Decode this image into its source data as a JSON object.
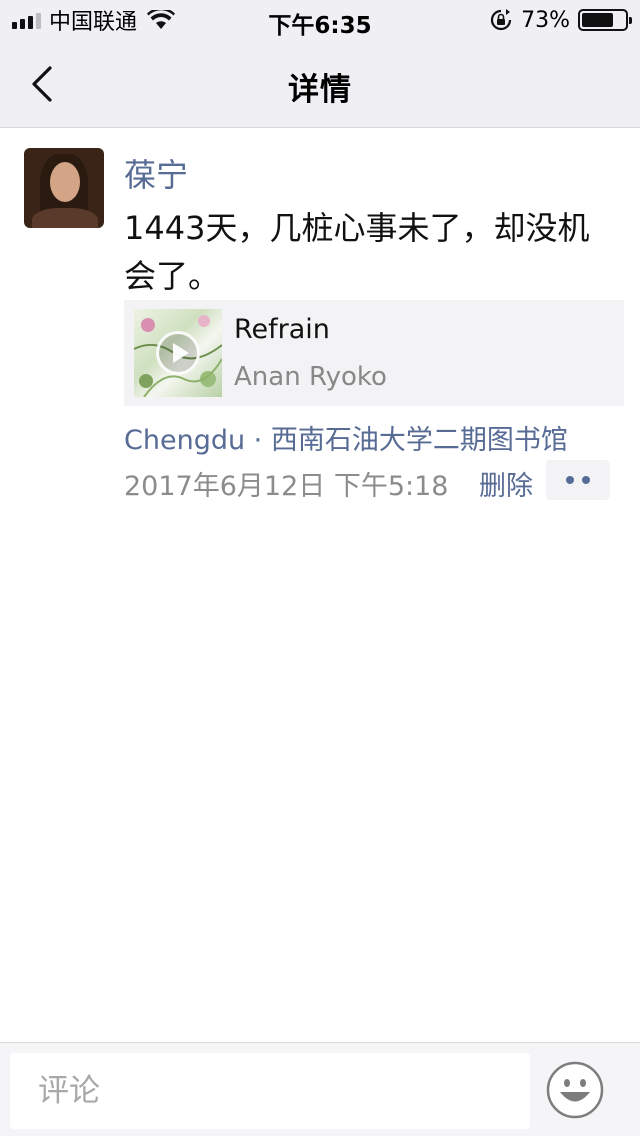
{
  "status_bar": {
    "carrier": "中国联通",
    "time": "下午6:35",
    "battery_text": "73%",
    "battery_level": 0.73
  },
  "nav": {
    "title": "详情",
    "back_icon": "chevron-left-icon"
  },
  "post": {
    "username": "葆宁",
    "text": "1443天，几桩心事未了，却没机会了。",
    "music": {
      "title": "Refrain",
      "artist": "Anan Ryoko",
      "icon": "play-icon"
    },
    "location": "Chengdu · 西南石油大学二期图书馆",
    "time": "2017年6月12日 下午5:18",
    "delete_label": "删除",
    "more_icon": "more-dots-icon"
  },
  "comment_bar": {
    "placeholder": "评论",
    "value": "",
    "emoji_icon": "smiley-face-icon"
  },
  "colors": {
    "link": "#576b95",
    "bar_background": "#efeff4",
    "meta_gray": "#8c8c8c"
  }
}
